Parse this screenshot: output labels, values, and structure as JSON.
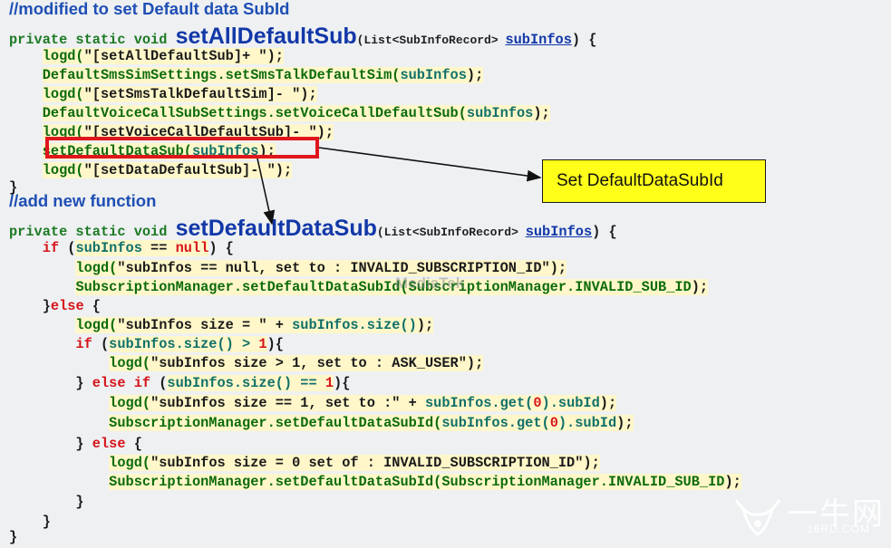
{
  "lines": [
    [
      {
        "t": "//modified to set Default data SubId",
        "c": "cm"
      }
    ],
    [
      {
        "t": "private static void ",
        "c": "kw"
      },
      {
        "t": "setAllDefaultSub",
        "c": "big"
      },
      {
        "t": "(List<SubInfoRecord> ",
        "c": "sig"
      },
      {
        "t": "subInfos",
        "c": "u"
      },
      {
        "t": ") {",
        "c": "pn"
      }
    ],
    [
      {
        "t": "    ",
        "c": "pn"
      },
      {
        "t": "logd(",
        "c": "fn hl"
      },
      {
        "t": "\"[setAllDefaultSub]+ \"",
        "c": "str hl"
      },
      {
        "t": ");",
        "c": "pn hl"
      }
    ],
    [
      {
        "t": "    ",
        "c": "pn"
      },
      {
        "t": "DefaultSmsSimSettings.setSmsTalkDefaultSim(",
        "c": "fn hl"
      },
      {
        "t": "subInfos",
        "c": "tl hl"
      },
      {
        "t": ");",
        "c": "pn hl"
      }
    ],
    [
      {
        "t": "    ",
        "c": "pn"
      },
      {
        "t": "logd(",
        "c": "fn hl"
      },
      {
        "t": "\"[setSmsTalkDefaultSim]- \"",
        "c": "str hl"
      },
      {
        "t": ");",
        "c": "pn hl"
      }
    ],
    [
      {
        "t": "    ",
        "c": "pn"
      },
      {
        "t": "DefaultVoiceCallSubSettings.setVoiceCallDefaultSub(",
        "c": "fn hl"
      },
      {
        "t": "subInfos",
        "c": "tl hl"
      },
      {
        "t": ");",
        "c": "pn hl"
      }
    ],
    [
      {
        "t": "    ",
        "c": "pn"
      },
      {
        "t": "logd(",
        "c": "fn hl"
      },
      {
        "t": "\"[setVoiceCallDefaultSub]- \"",
        "c": "str hl"
      },
      {
        "t": ");",
        "c": "pn hl"
      }
    ],
    [
      {
        "t": "    ",
        "c": "pn"
      },
      {
        "t": "setDefaultDataSub(",
        "c": "fn hl"
      },
      {
        "t": "subInfos",
        "c": "tl hl"
      },
      {
        "t": ");",
        "c": "pn hl"
      }
    ],
    [
      {
        "t": "    ",
        "c": "pn"
      },
      {
        "t": "logd(",
        "c": "fn hl"
      },
      {
        "t": "\"[setDataDefaultSub]- \"",
        "c": "str hl"
      },
      {
        "t": ");",
        "c": "pn hl"
      }
    ],
    [
      {
        "t": "}",
        "c": "pn"
      }
    ],
    [
      {
        "t": "//add new function",
        "c": "cm"
      }
    ],
    [
      {
        "t": "private static void ",
        "c": "kw"
      },
      {
        "t": "setDefaultDataSub",
        "c": "big"
      },
      {
        "t": "(List<SubInfoRecord> ",
        "c": "sig"
      },
      {
        "t": "subInfos",
        "c": "u"
      },
      {
        "t": ") {",
        "c": "pn"
      }
    ],
    [
      {
        "t": "    ",
        "c": "pn"
      },
      {
        "t": "if",
        "c": "red"
      },
      {
        "t": " (",
        "c": "pn"
      },
      {
        "t": "subInfos",
        "c": "tl hl"
      },
      {
        "t": " == ",
        "c": "pn hl"
      },
      {
        "t": "null",
        "c": "red hl"
      },
      {
        "t": ") {",
        "c": "pn"
      }
    ],
    [
      {
        "t": "        ",
        "c": "pn"
      },
      {
        "t": "logd(",
        "c": "fn hl"
      },
      {
        "t": "\"subInfos == null, set to : INVALID_SUBSCRIPTION_ID\"",
        "c": "str hl"
      },
      {
        "t": ");",
        "c": "pn hl"
      }
    ],
    [
      {
        "t": "        ",
        "c": "pn"
      },
      {
        "t": "SubscriptionManager.setDefaultDataSubId(",
        "c": "fn hl"
      },
      {
        "t": "SubscriptionManager.INVALID_SUB_ID",
        "c": "fn hl"
      },
      {
        "t": ");",
        "c": "pn hl"
      }
    ],
    [
      {
        "t": "    }",
        "c": "pn"
      },
      {
        "t": "else",
        "c": "red"
      },
      {
        "t": " {",
        "c": "pn"
      }
    ],
    [
      {
        "t": "        ",
        "c": "pn"
      },
      {
        "t": "logd(",
        "c": "fn hl"
      },
      {
        "t": "\"subInfos size = \"",
        "c": "str hl"
      },
      {
        "t": " + ",
        "c": "pn hl"
      },
      {
        "t": "subInfos.size()",
        "c": "tl hl"
      },
      {
        "t": ");",
        "c": "pn hl"
      }
    ],
    [
      {
        "t": "        ",
        "c": "pn"
      },
      {
        "t": "if",
        "c": "red"
      },
      {
        "t": " (",
        "c": "pn"
      },
      {
        "t": "subInfos.size() > ",
        "c": "tl hl"
      },
      {
        "t": "1",
        "c": "num hl"
      },
      {
        "t": "){",
        "c": "pn"
      }
    ],
    [
      {
        "t": "            ",
        "c": "pn"
      },
      {
        "t": "logd(",
        "c": "fn hl"
      },
      {
        "t": "\"subInfos size > 1, set to : ASK_USER\"",
        "c": "str hl"
      },
      {
        "t": ");",
        "c": "pn hl"
      }
    ],
    [
      {
        "t": "        } ",
        "c": "pn"
      },
      {
        "t": "else if",
        "c": "red"
      },
      {
        "t": " (",
        "c": "pn"
      },
      {
        "t": "subInfos.size() == ",
        "c": "tl hl"
      },
      {
        "t": "1",
        "c": "num hl"
      },
      {
        "t": "){",
        "c": "pn"
      }
    ],
    [
      {
        "t": "            ",
        "c": "pn"
      },
      {
        "t": "logd(",
        "c": "fn hl"
      },
      {
        "t": "\"subInfos size == 1, set to :\"",
        "c": "str hl"
      },
      {
        "t": " + ",
        "c": "pn hl"
      },
      {
        "t": "subInfos.get(",
        "c": "tl hl"
      },
      {
        "t": "0",
        "c": "num hl"
      },
      {
        "t": ").subId",
        "c": "tl hl"
      },
      {
        "t": ");",
        "c": "pn hl"
      }
    ],
    [
      {
        "t": "            ",
        "c": "pn"
      },
      {
        "t": "SubscriptionManager.setDefaultDataSubId(",
        "c": "fn hl"
      },
      {
        "t": "subInfos.get(",
        "c": "tl hl"
      },
      {
        "t": "0",
        "c": "num hl"
      },
      {
        "t": ").subId",
        "c": "tl hl"
      },
      {
        "t": ");",
        "c": "pn hl"
      }
    ],
    [
      {
        "t": "        } ",
        "c": "pn"
      },
      {
        "t": "else",
        "c": "red"
      },
      {
        "t": " {",
        "c": "pn"
      }
    ],
    [
      {
        "t": "            ",
        "c": "pn"
      },
      {
        "t": "logd(",
        "c": "fn hl"
      },
      {
        "t": "\"subInfos size = 0 set of : INVALID_SUBSCRIPTION_ID\"",
        "c": "str hl"
      },
      {
        "t": ");",
        "c": "pn hl"
      }
    ],
    [
      {
        "t": "            ",
        "c": "pn"
      },
      {
        "t": "SubscriptionManager.setDefaultDataSubId(",
        "c": "fn hl"
      },
      {
        "t": "SubscriptionManager.INVALID_SUB_ID",
        "c": "fn hl"
      },
      {
        "t": ");",
        "c": "pn hl"
      }
    ],
    [
      {
        "t": "        }",
        "c": "pn"
      }
    ],
    [
      {
        "t": "    }",
        "c": "pn"
      }
    ],
    [
      {
        "t": "}",
        "c": "pn"
      }
    ]
  ],
  "callout": {
    "label": "Set DefaultDataSubId"
  },
  "watermark": {
    "faint_text": "MediaTek"
  },
  "logo": {
    "main": "一牛网",
    "sub": "16RD.COM"
  },
  "colors": {
    "comment": "#1f4fb5",
    "keyword_red": "#d6141a",
    "code_green": "#0b6b0b",
    "highlight": "#fff7c9",
    "callout_bg": "#ffff1a",
    "box_red": "#e0161d"
  }
}
